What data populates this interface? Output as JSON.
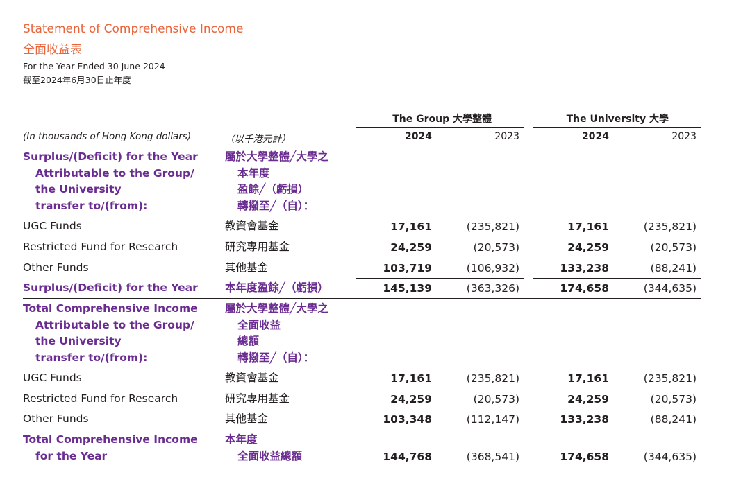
{
  "title_en": "Statement of Comprehensive Income",
  "title_zh": "全面收益表",
  "period_en": "For the Year Ended 30 June 2024",
  "period_zh": "截至2024年6月30日止年度",
  "header": {
    "group": "The Group 大學整體",
    "university": "The University 大學",
    "unit_en": "(In thousands of Hong Kong dollars)",
    "unit_zh": "（以千港元計）",
    "years": [
      "2024",
      "2023",
      "2024",
      "2023"
    ]
  },
  "section1": {
    "heading_en": [
      "Surplus/(Deficit) for the Year",
      "Attributable to the Group/",
      "the University",
      "transfer to/(from):"
    ],
    "heading_zh": [
      "屬於大學整體╱大學之",
      "本年度",
      "盈餘╱（虧損）",
      "轉撥至╱（自）："
    ],
    "rows": [
      {
        "en": "UGC Funds",
        "zh": "教資會基金",
        "v": [
          "17,161",
          "(235,821)",
          "17,161",
          "(235,821)"
        ]
      },
      {
        "en": "Restricted Fund for Research",
        "zh": "研究專用基金",
        "v": [
          "24,259",
          "(20,573)",
          "24,259",
          "(20,573)"
        ]
      },
      {
        "en": "Other Funds",
        "zh": "其他基金",
        "v": [
          "103,719",
          "(106,932)",
          "133,238",
          "(88,241)"
        ]
      }
    ],
    "total": {
      "en": "Surplus/(Deficit) for the Year",
      "zh": "本年度盈餘╱（虧損）",
      "v": [
        "145,139",
        "(363,326)",
        "174,658",
        "(344,635)"
      ]
    }
  },
  "section2": {
    "heading_en": [
      "Total Comprehensive Income",
      "Attributable to the Group/",
      "the University",
      "transfer to/(from):"
    ],
    "heading_zh": [
      "屬於大學整體╱大學之",
      "全面收益",
      "總額",
      "轉撥至╱（自）："
    ],
    "rows": [
      {
        "en": "UGC Funds",
        "zh": "教資會基金",
        "v": [
          "17,161",
          "(235,821)",
          "17,161",
          "(235,821)"
        ]
      },
      {
        "en": "Restricted Fund for Research",
        "zh": "研究專用基金",
        "v": [
          "24,259",
          "(20,573)",
          "24,259",
          "(20,573)"
        ]
      },
      {
        "en": "Other Funds",
        "zh": "其他基金",
        "v": [
          "103,348",
          "(112,147)",
          "133,238",
          "(88,241)"
        ]
      }
    ],
    "total": {
      "en": [
        "Total Comprehensive Income",
        "for the Year"
      ],
      "zh": [
        "本年度",
        "全面收益總額"
      ],
      "v": [
        "144,768",
        "(368,541)",
        "174,658",
        "(344,635)"
      ]
    }
  }
}
